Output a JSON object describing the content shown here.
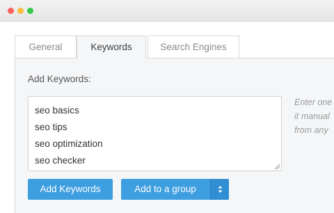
{
  "window": {
    "controls": [
      "close",
      "minimize",
      "zoom"
    ]
  },
  "tabs": [
    {
      "label": "General",
      "active": false
    },
    {
      "label": "Keywords",
      "active": true
    },
    {
      "label": "Search Engines",
      "active": false
    }
  ],
  "keywords_panel": {
    "label": "Add Keywords:",
    "keywords": [
      "seo basics",
      "seo tips",
      "seo optimization",
      "seo checker"
    ],
    "hint_lines": [
      "Enter one",
      "it manual",
      "from any"
    ]
  },
  "buttons": {
    "add_keywords": "Add Keywords",
    "add_to_group": "Add to a group"
  },
  "colors": {
    "accent": "#3d9ee0",
    "panel_bg": "#f4f6f8"
  }
}
